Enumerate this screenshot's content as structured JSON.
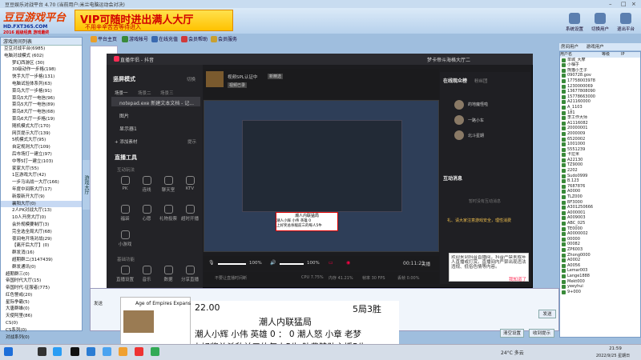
{
  "titlebar": {
    "title": "豆豆娱乐对战平台 4.70 (当前用户:米兰电脑运动会对决)"
  },
  "banner": {
    "logo_main": "豆豆游戏平台",
    "logo_sub": "HD.FXT365.COM",
    "logo_tag": "2016 超级经典 游戏最终",
    "vip_main": "VIP可随时进出满人大厅",
    "vip_sub": "不用辛辛苦苦等待进入"
  },
  "toolbar": [
    "平台主页",
    "游戏帐号",
    "在线充值",
    "会员帮助",
    "会员服务"
  ],
  "right_tools": [
    "系统设置",
    "切换用户",
    "退出平台"
  ],
  "sidebar": {
    "title": "游戏房间列表",
    "items": [
      "豆豆对战平台(6985)",
      "电脑对战模式 (602)",
      "梦幻西游区 (30)",
      "30级动作一步格(198)",
      "快手大厅一步格(131)",
      "电脑试验体系列(63)",
      "菜鸟大厅一步格(91)",
      "菜鸟5大厅一电信(96)",
      "菜鸟5大厅一电信(89)",
      "菜鸟8大厅一电信(68)",
      "菜鸟6大厅一步格(19)",
      "随机模式大厅(170)",
      "网页提示大厅(139)",
      "5机模式大厅(95)",
      "自定规则大厅(109)",
      "后市场打一建立(97)",
      "中等5打一建立(103)",
      "家家大厅(55)",
      "1区游戏大厅(42)",
      "一步马出战一大厅(166)",
      "年度中间斯大厅(17)",
      "新版新开大厅(9)",
      "襄阳大厅(0)",
      "2人PK对战大厅(13)",
      "10人开房大厅(0)",
      "会外规模要制厅(3)",
      "完全选全局大厅(68)",
      "夜间电开场对战(29)",
      "【离开后大厅】(0)",
      "群发消(16)",
      "超期群二(3147439)",
      "群发通讯(0)",
      "超期群三(0)",
      "帝国时代大厅(15)",
      "帝国时代·征服者(775)",
      "红色警戒(20)",
      "星际争霸(5)",
      "大唐群雄(0)",
      "天使阿里(86)",
      "CS(0)",
      "CS系列(0)",
      "对战系列(0)"
    ],
    "selected": 22
  },
  "vtab": "游戏大厅",
  "douyin": {
    "title": "直播伴侣 - 抖音",
    "user": "梦卡帝斗海格大厅二",
    "mode_label": "竖屏模式",
    "mode_hint": "切换",
    "scene_tabs": [
      "场景一",
      "场景二",
      "场景三"
    ],
    "sources": [
      "notepad.exe 新建文本文档 - 记...",
      "图片",
      "显示器1"
    ],
    "add_source": "+ 添加素材",
    "source_hint": "提示",
    "tools_title": "直播工具",
    "tool_group1": "互动玩法",
    "tools1": [
      "PK",
      "连线",
      "聊天室",
      "KTV"
    ],
    "tools2": [
      "福袋",
      "心愿",
      "礼物投票",
      "超时开播"
    ],
    "tools3": [
      "小游戏"
    ],
    "tool_group2": "基础功能",
    "tools4": [
      "直播设置",
      "音乐",
      "数据",
      "分享直播"
    ],
    "preview_title": "视频SPL认证中",
    "preview_tags": [
      "视频已录",
      "新精选"
    ],
    "vol_mic": "100%",
    "vol_sys": "100%",
    "timer": "00:11:23",
    "end_button": "关播",
    "stats": [
      "CPU 7.75%",
      "内存 41.21%",
      "帧率 30 FPS",
      "丢帧 0.00%"
    ],
    "watch_hint": "不要让直播时间断",
    "online_title": "在线观众榜",
    "fans_tab": "粉丝团",
    "audience": [
      "的地魔怪啦",
      "一路小车",
      "北斗星期"
    ],
    "interact_title": "互动消息",
    "interact_hint": "暂时没有互动消息",
    "hint_bar": "礼、请大家注意游戏安全，理性消费",
    "dialog_text": "欢迎来到抖音直播间，抖音严禁未成年人直播或打赏。直播间内严禁出现违法违规、低俗色情等内容。",
    "dialog_btn": "我知道了"
  },
  "innerwin": {
    "title": "潮人内联猛局",
    "rows": [
      "潮人小辉 小伟 英雄 0",
      "潮人怒 小章 老梦",
      "上好奖总杀敌前三的每人5牛"
    ]
  },
  "rightpanel": {
    "tabs": [
      "房间用户",
      "游戏用户"
    ],
    "header": [
      "用户名",
      "等级",
      "IP"
    ],
    "users": [
      "单城_大摩",
      "小柚子",
      "熊猫小王子",
      "090728.gov",
      "17758003978",
      "1230000069",
      "13677808090",
      "15778663000",
      "A21160000",
      "A_1103",
      "181",
      "李工作大师",
      "A1116082",
      "20000001",
      "2000009",
      "6520002",
      "1001000",
      "5551239",
      "卡拉米",
      "A22130",
      "TZ9000",
      "2202",
      "Sudo0999",
      "B.123",
      "7687876",
      "A0000",
      "TLZ000",
      "BF3000",
      "A301250666",
      "A000001",
      "A009003",
      "ABC_025",
      "TE0000",
      "A0000002",
      "00000",
      "00082",
      "ZP6003",
      "Zhong0000",
      "A0002",
      "A0056",
      "Lemar003",
      "Lange1888",
      "Mekt000",
      "yeeyhui",
      "9+000"
    ]
  },
  "bottom": {
    "input_label": "发送",
    "buttons": [
      "发送",
      "清空设置",
      "收到提示"
    ],
    "user_label": "用户"
  },
  "age": {
    "title": "Age of Empires Expansion"
  },
  "overlay": {
    "time": "22.00",
    "score": "5局3胜",
    "line1": "潮人内联猛局",
    "line2": "潮人小辉 小伟 英雄 0 ： 0 潮人怒 小章 老梦",
    "line3": "上好奖总杀敌前三的每人5牛   队费赞助主播5牛"
  },
  "taskbar": {
    "weather": "24°C 多云",
    "time": "21:59",
    "date": "2022/9/25 星期日"
  }
}
